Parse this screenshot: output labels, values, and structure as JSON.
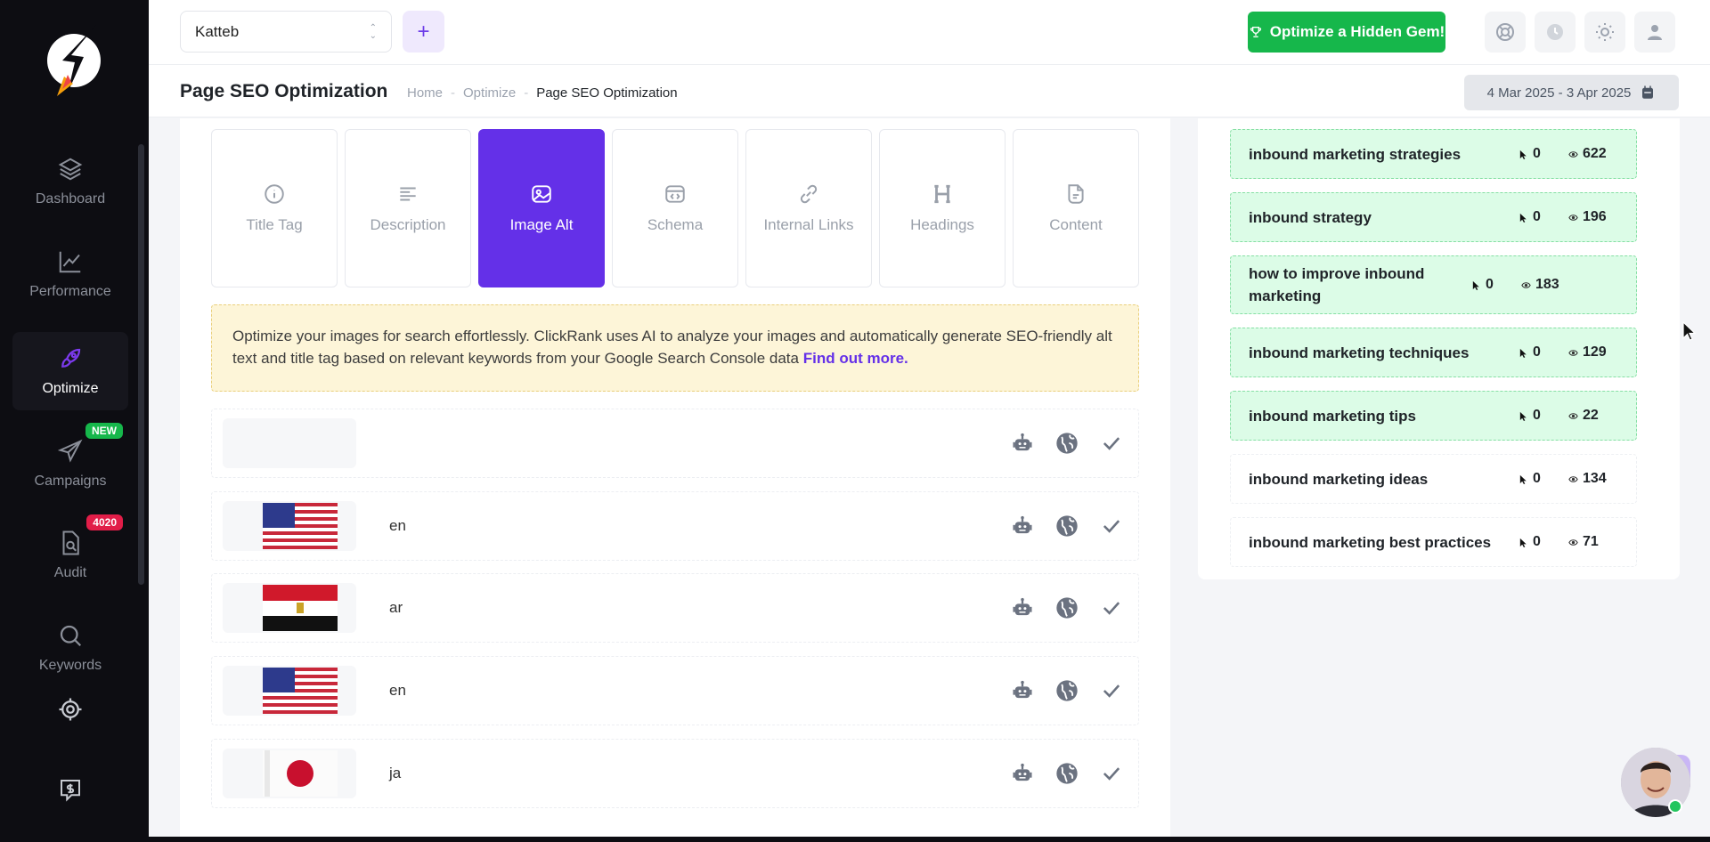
{
  "colors": {
    "sidebar_bg": "#0d0d12",
    "accent": "#6430e8",
    "green_btn": "#16b74b",
    "keyword_green": "#dcfce7"
  },
  "sidebar": {
    "items": [
      {
        "label": "Dashboard",
        "icon": "layers-icon"
      },
      {
        "label": "Performance",
        "icon": "chart-line-icon"
      },
      {
        "label": "Optimize",
        "icon": "rocket-icon",
        "active": true
      },
      {
        "label": "Campaigns",
        "icon": "paper-plane-icon",
        "badge": "NEW"
      },
      {
        "label": "Audit",
        "icon": "file-search-icon",
        "badge": "4020"
      },
      {
        "label": "Keywords",
        "icon": "search-icon"
      }
    ],
    "extra_icons": [
      "target-icon",
      "dollar-chat-icon"
    ]
  },
  "header": {
    "project": "Katteb",
    "add_label": "+",
    "hidden_gem_label": "Optimize a Hidden Gem!",
    "icons": [
      "lifebuoy-icon",
      "clock-icon",
      "sun-icon",
      "user-icon"
    ]
  },
  "subheader": {
    "title": "Page SEO Optimization",
    "breadcrumb": [
      "Home",
      "Optimize",
      "Page SEO Optimization"
    ],
    "date_range": "4 Mar 2025 - 3 Apr 2025"
  },
  "tabs": [
    {
      "label": "Title Tag",
      "icon": "info-icon"
    },
    {
      "label": "Description",
      "icon": "lines-icon"
    },
    {
      "label": "Image Alt",
      "icon": "image-icon",
      "active": true
    },
    {
      "label": "Schema",
      "icon": "code-window-icon"
    },
    {
      "label": "Internal Links",
      "icon": "link-icon"
    },
    {
      "label": "Headings",
      "icon": "heading-icon"
    },
    {
      "label": "Content",
      "icon": "document-icon"
    }
  ],
  "notice": {
    "text": "Optimize your images for search effortlessly. ClickRank uses AI to analyze your images and automatically generate SEO-friendly alt text and title tag based on relevant keywords from your Google Search Console data",
    "link": "Find out more."
  },
  "image_rows": [
    {
      "lang": "",
      "flag": ""
    },
    {
      "lang": "en",
      "flag": "us"
    },
    {
      "lang": "ar",
      "flag": "eg"
    },
    {
      "lang": "en",
      "flag": "us"
    },
    {
      "lang": "ja",
      "flag": "jp"
    }
  ],
  "keywords": [
    {
      "text": "inbound marketing strategies",
      "clicks": "0",
      "impressions": "622",
      "highlight": true
    },
    {
      "text": "inbound strategy",
      "clicks": "0",
      "impressions": "196",
      "highlight": true
    },
    {
      "text": "how to improve inbound marketing",
      "clicks": "0",
      "impressions": "183",
      "highlight": true
    },
    {
      "text": "inbound marketing techniques",
      "clicks": "0",
      "impressions": "129",
      "highlight": true
    },
    {
      "text": "inbound marketing tips",
      "clicks": "0",
      "impressions": "22",
      "highlight": true
    },
    {
      "text": "inbound marketing ideas",
      "clicks": "0",
      "impressions": "134",
      "highlight": false
    },
    {
      "text": "inbound marketing best practices",
      "clicks": "0",
      "impressions": "71",
      "highlight": false
    }
  ]
}
